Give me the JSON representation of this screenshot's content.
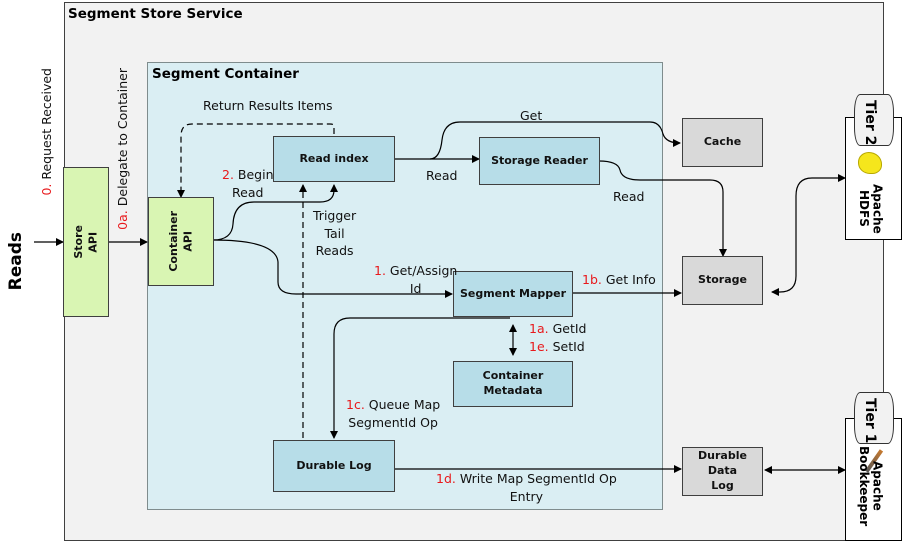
{
  "diagram": {
    "side_label": "Reads",
    "service_title": "Segment Store Service",
    "container_title": "Segment Container",
    "components": {
      "store_api": "Store API",
      "container_api_line1": "Container",
      "container_api_line2": "API",
      "store_api_line1": "Store",
      "store_api_line2": "API",
      "read_index": "Read index",
      "storage_reader": "Storage Reader",
      "segment_mapper": "Segment Mapper",
      "container_metadata": "Container Metadata",
      "durable_log": "Durable Log",
      "cache": "Cache",
      "storage": "Storage",
      "durable_data_log_line1": "Durable Data",
      "durable_data_log_line2": "Log"
    },
    "tiers": [
      {
        "tier": "Tier 2",
        "product_line1": "Apache",
        "product_line2": "HDFS",
        "icon": "hadoop-elephant-icon"
      },
      {
        "tier": "Tier 1",
        "product_line1": "Apache",
        "product_line2": "Bookkeeper",
        "icon": "bookkeeper-feather-icon"
      }
    ],
    "edges": {
      "request_received": {
        "num": "0.",
        "text": " Request Received"
      },
      "delegate": {
        "num": "0a.",
        "text": " Delegate to Container"
      },
      "return_results": "Return Results Items",
      "begin_read": {
        "num": "2.",
        "text": " Begin",
        "line2": "Read"
      },
      "trigger_tail": {
        "line1": "Trigger",
        "line2": "Tail",
        "line3": "Reads"
      },
      "get": "Get",
      "read1": "Read",
      "read2": "Read",
      "get_assign": {
        "num": "1.",
        "text": " Get/Assign",
        "line2": "Id"
      },
      "get_info": {
        "num": "1b.",
        "text": " Get Info"
      },
      "get_id": {
        "num": "1a.",
        "text": " GetId"
      },
      "set_id": {
        "num": "1e.",
        "text": " SetId"
      },
      "queue_map": {
        "num": "1c.",
        "text": " Queue Map",
        "line2": "SegmentId Op"
      },
      "write_map": {
        "num": "1d.",
        "text": " Write Map SegmentId Op",
        "line2": "Entry"
      }
    },
    "colors": {
      "step_number": "#e8191c",
      "container_bg": "#daeef3",
      "service_bg": "#f2f2f2",
      "api_green": "#d9f5b3",
      "component_blue": "#b7dde8",
      "external_grey": "#d9d9d9"
    }
  }
}
